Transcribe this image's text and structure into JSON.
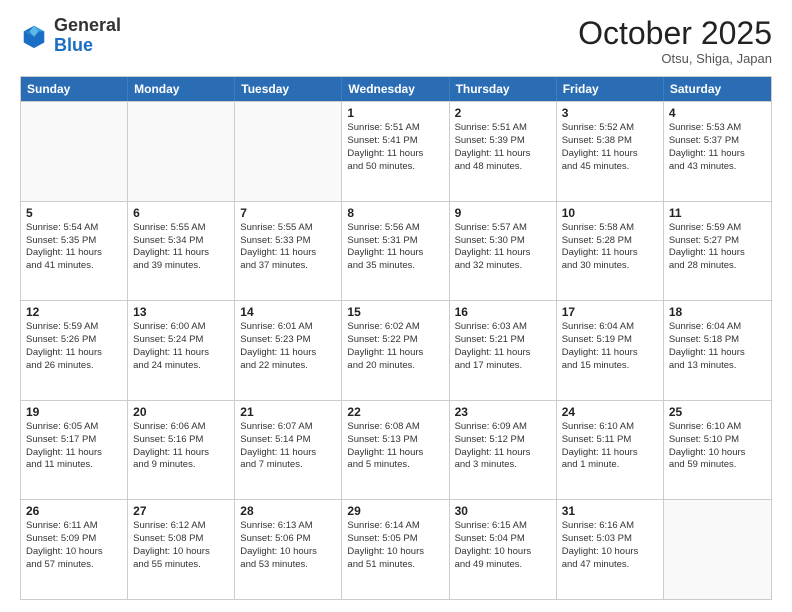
{
  "header": {
    "logo_general": "General",
    "logo_blue": "Blue",
    "month": "October 2025",
    "location": "Otsu, Shiga, Japan"
  },
  "weekdays": [
    "Sunday",
    "Monday",
    "Tuesday",
    "Wednesday",
    "Thursday",
    "Friday",
    "Saturday"
  ],
  "rows": [
    [
      {
        "day": "",
        "info": ""
      },
      {
        "day": "",
        "info": ""
      },
      {
        "day": "",
        "info": ""
      },
      {
        "day": "1",
        "info": "Sunrise: 5:51 AM\nSunset: 5:41 PM\nDaylight: 11 hours\nand 50 minutes."
      },
      {
        "day": "2",
        "info": "Sunrise: 5:51 AM\nSunset: 5:39 PM\nDaylight: 11 hours\nand 48 minutes."
      },
      {
        "day": "3",
        "info": "Sunrise: 5:52 AM\nSunset: 5:38 PM\nDaylight: 11 hours\nand 45 minutes."
      },
      {
        "day": "4",
        "info": "Sunrise: 5:53 AM\nSunset: 5:37 PM\nDaylight: 11 hours\nand 43 minutes."
      }
    ],
    [
      {
        "day": "5",
        "info": "Sunrise: 5:54 AM\nSunset: 5:35 PM\nDaylight: 11 hours\nand 41 minutes."
      },
      {
        "day": "6",
        "info": "Sunrise: 5:55 AM\nSunset: 5:34 PM\nDaylight: 11 hours\nand 39 minutes."
      },
      {
        "day": "7",
        "info": "Sunrise: 5:55 AM\nSunset: 5:33 PM\nDaylight: 11 hours\nand 37 minutes."
      },
      {
        "day": "8",
        "info": "Sunrise: 5:56 AM\nSunset: 5:31 PM\nDaylight: 11 hours\nand 35 minutes."
      },
      {
        "day": "9",
        "info": "Sunrise: 5:57 AM\nSunset: 5:30 PM\nDaylight: 11 hours\nand 32 minutes."
      },
      {
        "day": "10",
        "info": "Sunrise: 5:58 AM\nSunset: 5:28 PM\nDaylight: 11 hours\nand 30 minutes."
      },
      {
        "day": "11",
        "info": "Sunrise: 5:59 AM\nSunset: 5:27 PM\nDaylight: 11 hours\nand 28 minutes."
      }
    ],
    [
      {
        "day": "12",
        "info": "Sunrise: 5:59 AM\nSunset: 5:26 PM\nDaylight: 11 hours\nand 26 minutes."
      },
      {
        "day": "13",
        "info": "Sunrise: 6:00 AM\nSunset: 5:24 PM\nDaylight: 11 hours\nand 24 minutes."
      },
      {
        "day": "14",
        "info": "Sunrise: 6:01 AM\nSunset: 5:23 PM\nDaylight: 11 hours\nand 22 minutes."
      },
      {
        "day": "15",
        "info": "Sunrise: 6:02 AM\nSunset: 5:22 PM\nDaylight: 11 hours\nand 20 minutes."
      },
      {
        "day": "16",
        "info": "Sunrise: 6:03 AM\nSunset: 5:21 PM\nDaylight: 11 hours\nand 17 minutes."
      },
      {
        "day": "17",
        "info": "Sunrise: 6:04 AM\nSunset: 5:19 PM\nDaylight: 11 hours\nand 15 minutes."
      },
      {
        "day": "18",
        "info": "Sunrise: 6:04 AM\nSunset: 5:18 PM\nDaylight: 11 hours\nand 13 minutes."
      }
    ],
    [
      {
        "day": "19",
        "info": "Sunrise: 6:05 AM\nSunset: 5:17 PM\nDaylight: 11 hours\nand 11 minutes."
      },
      {
        "day": "20",
        "info": "Sunrise: 6:06 AM\nSunset: 5:16 PM\nDaylight: 11 hours\nand 9 minutes."
      },
      {
        "day": "21",
        "info": "Sunrise: 6:07 AM\nSunset: 5:14 PM\nDaylight: 11 hours\nand 7 minutes."
      },
      {
        "day": "22",
        "info": "Sunrise: 6:08 AM\nSunset: 5:13 PM\nDaylight: 11 hours\nand 5 minutes."
      },
      {
        "day": "23",
        "info": "Sunrise: 6:09 AM\nSunset: 5:12 PM\nDaylight: 11 hours\nand 3 minutes."
      },
      {
        "day": "24",
        "info": "Sunrise: 6:10 AM\nSunset: 5:11 PM\nDaylight: 11 hours\nand 1 minute."
      },
      {
        "day": "25",
        "info": "Sunrise: 6:10 AM\nSunset: 5:10 PM\nDaylight: 10 hours\nand 59 minutes."
      }
    ],
    [
      {
        "day": "26",
        "info": "Sunrise: 6:11 AM\nSunset: 5:09 PM\nDaylight: 10 hours\nand 57 minutes."
      },
      {
        "day": "27",
        "info": "Sunrise: 6:12 AM\nSunset: 5:08 PM\nDaylight: 10 hours\nand 55 minutes."
      },
      {
        "day": "28",
        "info": "Sunrise: 6:13 AM\nSunset: 5:06 PM\nDaylight: 10 hours\nand 53 minutes."
      },
      {
        "day": "29",
        "info": "Sunrise: 6:14 AM\nSunset: 5:05 PM\nDaylight: 10 hours\nand 51 minutes."
      },
      {
        "day": "30",
        "info": "Sunrise: 6:15 AM\nSunset: 5:04 PM\nDaylight: 10 hours\nand 49 minutes."
      },
      {
        "day": "31",
        "info": "Sunrise: 6:16 AM\nSunset: 5:03 PM\nDaylight: 10 hours\nand 47 minutes."
      },
      {
        "day": "",
        "info": ""
      }
    ]
  ]
}
